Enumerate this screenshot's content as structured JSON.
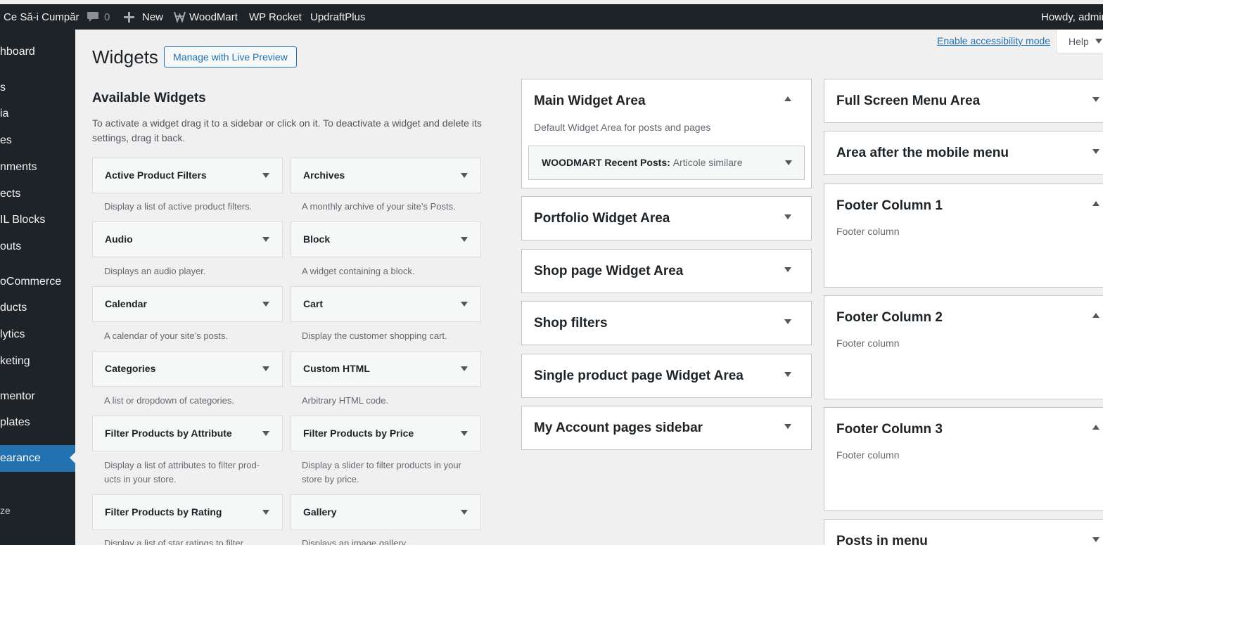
{
  "adminbar": {
    "site_name": "Ce Să-i Cumpăr",
    "comments_count": "0",
    "new_label": "New",
    "woodmart_label": "WoodMart",
    "wprocket_label": "WP Rocket",
    "updraft_label": "UpdraftPlus",
    "howdy": "Howdy, admin"
  },
  "sidemenu": {
    "items": [
      {
        "label": "hboard"
      },
      {
        "label": "s"
      },
      {
        "label": "ia"
      },
      {
        "label": "es"
      },
      {
        "label": "nments"
      },
      {
        "label": "ects"
      },
      {
        "label": "IL Blocks"
      },
      {
        "label": "outs"
      },
      {
        "label": "oCommerce"
      },
      {
        "label": "ducts"
      },
      {
        "label": "lytics"
      },
      {
        "label": "keting"
      },
      {
        "label": "mentor"
      },
      {
        "label": "plates"
      },
      {
        "label": "earance"
      },
      {
        "label": "ze"
      }
    ]
  },
  "header": {
    "title": "Widgets",
    "live_preview_label": "Manage with Live Preview",
    "accessibility_link": "Enable accessibility mode",
    "help_label": "Help"
  },
  "available": {
    "heading": "Available Widgets",
    "description": "To activate a widget drag it to a sidebar or click on it. To deactivate a widget and delete its settings, drag it back.",
    "widgets": [
      {
        "title": "Active Product Filters",
        "desc": "Display a list of active product filters."
      },
      {
        "title": "Archives",
        "desc": "A monthly archive of your site’s Posts."
      },
      {
        "title": "Audio",
        "desc": "Displays an audio player."
      },
      {
        "title": "Block",
        "desc": "A widget containing a block."
      },
      {
        "title": "Calendar",
        "desc": "A calendar of your site’s posts."
      },
      {
        "title": "Cart",
        "desc": "Display the customer shopping cart."
      },
      {
        "title": "Categories",
        "desc": "A list or dropdown of categories."
      },
      {
        "title": "Custom HTML",
        "desc": "Arbitrary HTML code."
      },
      {
        "title": "Filter Products by Attribute",
        "desc": "Display a list of attributes to filter prod-ucts in your store."
      },
      {
        "title": "Filter Products by Price",
        "desc": "Display a slider to filter products in your store by price."
      },
      {
        "title": "Filter Products by Rating",
        "desc": "Display a list of star ratings to filter"
      },
      {
        "title": "Gallery",
        "desc": "Displays an image gallery."
      }
    ]
  },
  "areas_col1": [
    {
      "title": "Main Widget Area",
      "desc": "Default Widget Area for posts and pages",
      "widget_name": "WOODMART Recent Posts",
      "widget_sep": ": ",
      "widget_title": "Articole similare"
    },
    {
      "title": "Portfolio Widget Area"
    },
    {
      "title": "Shop page Widget Area"
    },
    {
      "title": "Shop filters"
    },
    {
      "title": "Single product page Widget Area"
    },
    {
      "title": "My Account pages sidebar"
    }
  ],
  "areas_col2": [
    {
      "title": "Full Screen Menu Area"
    },
    {
      "title": "Area after the mobile menu"
    },
    {
      "title": "Footer Column 1",
      "desc": "Footer column"
    },
    {
      "title": "Footer Column 2",
      "desc": "Footer column"
    },
    {
      "title": "Footer Column 3",
      "desc": "Footer column"
    },
    {
      "title": "Posts in menu"
    }
  ]
}
